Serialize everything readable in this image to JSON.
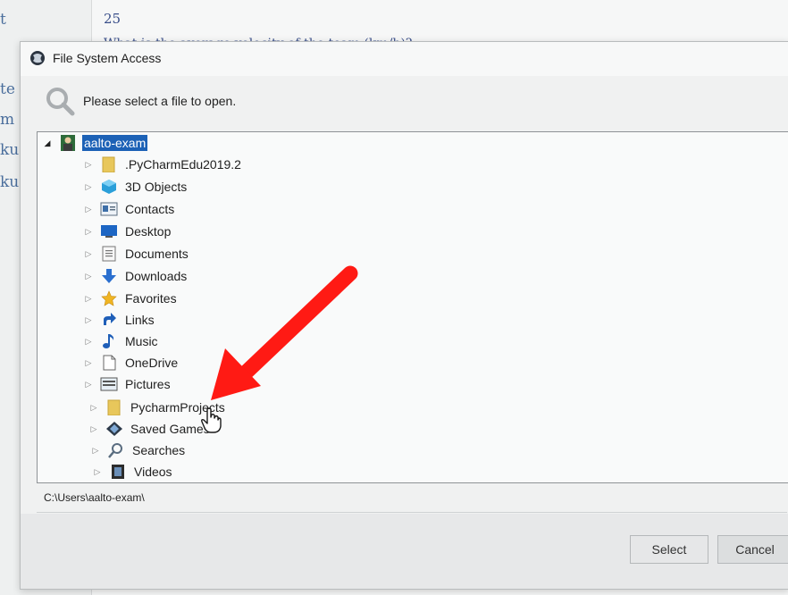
{
  "background": {
    "question_number": "25",
    "question_text": "What is the average velocity of the team (km/h)?",
    "gutter_fragments": [
      "t",
      "te",
      "m",
      "ku",
      "ku"
    ]
  },
  "dialog": {
    "title": "File System Access",
    "prompt": "Please select a file to open.",
    "root_label": "aalto-exam",
    "items": [
      {
        "label": ".PyCharmEdu2019.2",
        "icon": "folder-icon"
      },
      {
        "label": "3D Objects",
        "icon": "3d-objects-icon"
      },
      {
        "label": "Contacts",
        "icon": "contacts-icon"
      },
      {
        "label": "Desktop",
        "icon": "desktop-icon"
      },
      {
        "label": "Documents",
        "icon": "documents-icon"
      },
      {
        "label": "Downloads",
        "icon": "downloads-icon"
      },
      {
        "label": "Favorites",
        "icon": "star-icon"
      },
      {
        "label": "Links",
        "icon": "links-icon"
      },
      {
        "label": "Music",
        "icon": "music-note-icon"
      },
      {
        "label": "OneDrive",
        "icon": "onedrive-icon"
      },
      {
        "label": "Pictures",
        "icon": "pictures-icon"
      },
      {
        "label": "PycharmProjects",
        "icon": "folder-icon"
      },
      {
        "label": "Saved Games",
        "icon": "saved-games-icon"
      },
      {
        "label": "Searches",
        "icon": "searches-icon"
      },
      {
        "label": "Videos",
        "icon": "videos-icon"
      }
    ],
    "path": "C:\\Users\\aalto-exam\\",
    "select_label": "Select",
    "cancel_label": "Cancel"
  },
  "colors": {
    "selection": "#1c61b6",
    "annotation_arrow": "#ff1a14",
    "folder": "#e8c75b"
  }
}
